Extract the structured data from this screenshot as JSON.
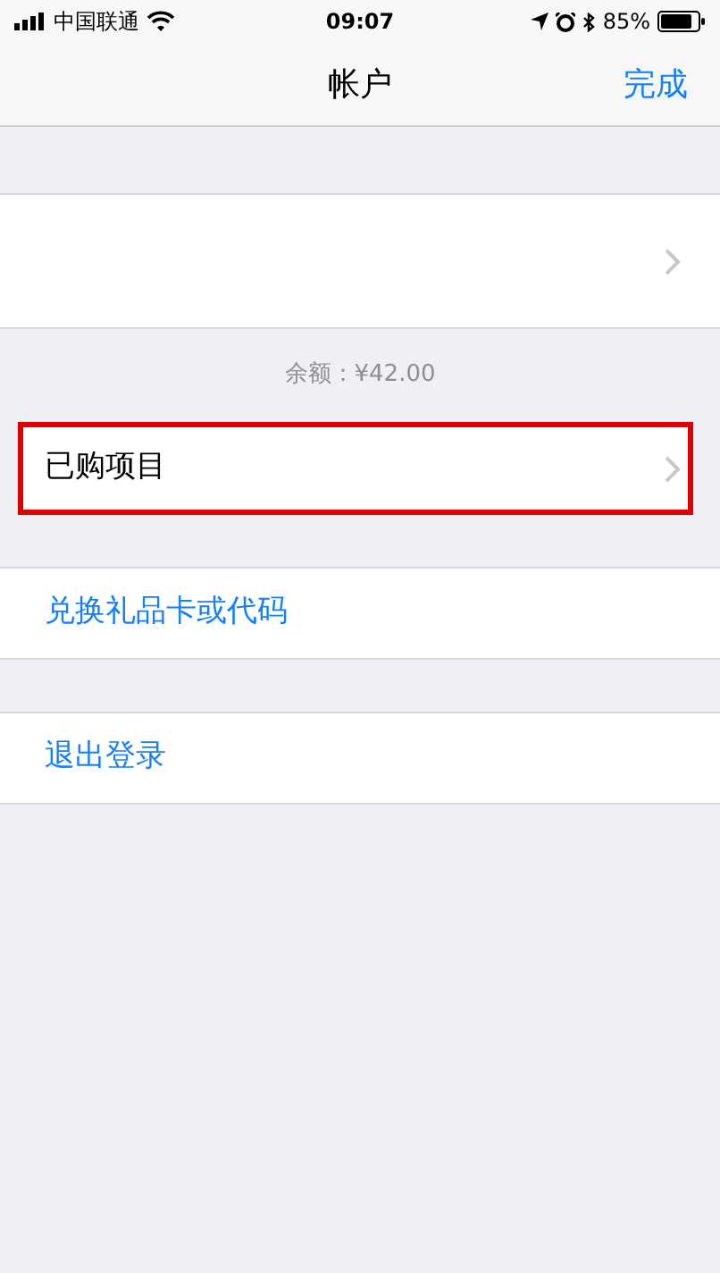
{
  "status_bar": {
    "carrier": "中国联通",
    "time": "09:07",
    "battery": "85%"
  },
  "nav": {
    "title": "帐户",
    "done": "完成"
  },
  "account_row": {
    "chevron": true
  },
  "balance": "余额：¥42.00",
  "groups": [
    {
      "label": "已购项目",
      "kind": "nav",
      "highlighted": true
    },
    {
      "label": "兑换礼品卡或代码",
      "kind": "action",
      "highlighted": false
    },
    {
      "label": "退出登录",
      "kind": "action",
      "highlighted": false
    }
  ]
}
